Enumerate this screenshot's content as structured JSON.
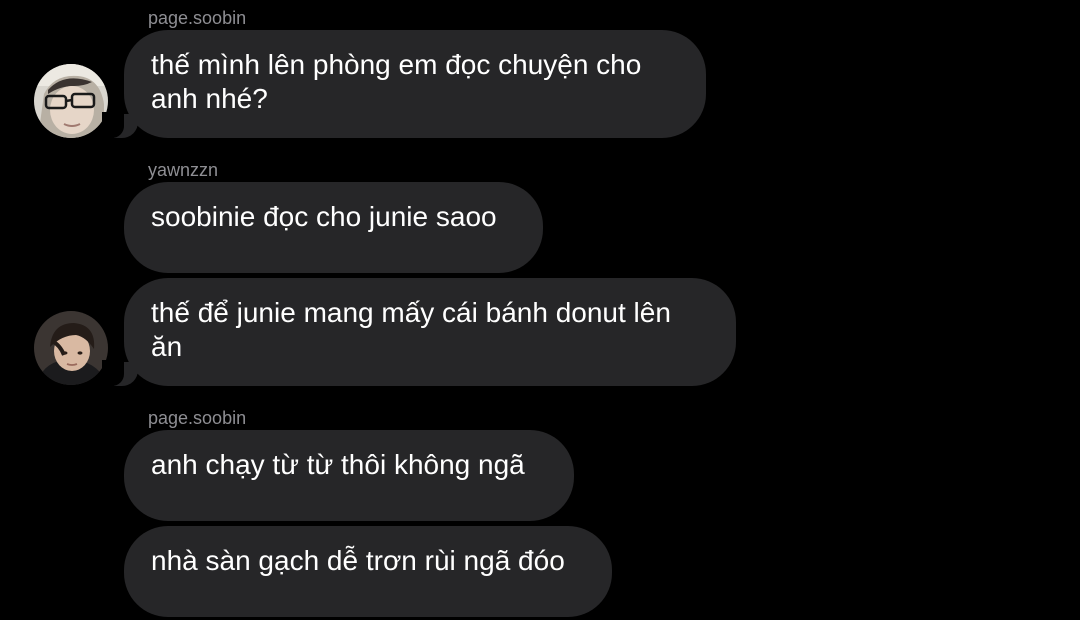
{
  "messages": [
    {
      "sender": "page.soobin",
      "text": "thế mình lên phòng em đọc chuyện cho anh nhé?"
    },
    {
      "sender": "yawnzzn",
      "text": "soobinie đọc cho junie saoo"
    },
    {
      "sender": "",
      "text": "thế để junie mang mấy cái bánh donut lên ăn"
    },
    {
      "sender": "page.soobin",
      "text": "anh chạy từ từ thôi không ngã"
    },
    {
      "sender": "",
      "text": "nhà sàn gạch dễ trơn rùi ngã đóo"
    }
  ],
  "colors": {
    "background": "#000000",
    "bubble": "#262628",
    "sender_name": "#8e8e93",
    "text": "#ffffff"
  }
}
